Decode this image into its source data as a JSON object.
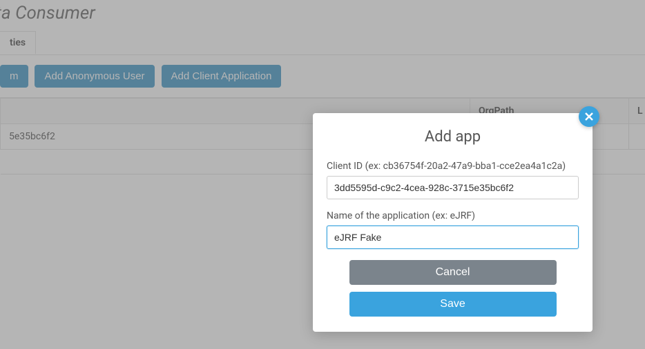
{
  "page": {
    "title_fragment": "ata Consumer"
  },
  "tabs": {
    "active_fragment": "ties"
  },
  "actions": {
    "btn0_fragment": "m",
    "btn1": "Add Anonymous User",
    "btn2": "Add Client Application"
  },
  "table": {
    "headers": {
      "orgpath": "OrgPath",
      "last_fragment": "L"
    },
    "rows": [
      {
        "cell0_fragment": "5e35bc6f2",
        "orgpath": "",
        "last": ""
      }
    ]
  },
  "modal": {
    "title": "Add app",
    "client_id_label": "Client ID (ex: cb36754f-20a2-47a9-bba1-cce2ea4a1c2a)",
    "client_id_value": "3dd5595d-c9c2-4cea-928c-3715e35bc6f2",
    "app_name_label": "Name of the application (ex: eJRF)",
    "app_name_value": "eJRF Fake",
    "cancel": "Cancel",
    "save": "Save"
  }
}
